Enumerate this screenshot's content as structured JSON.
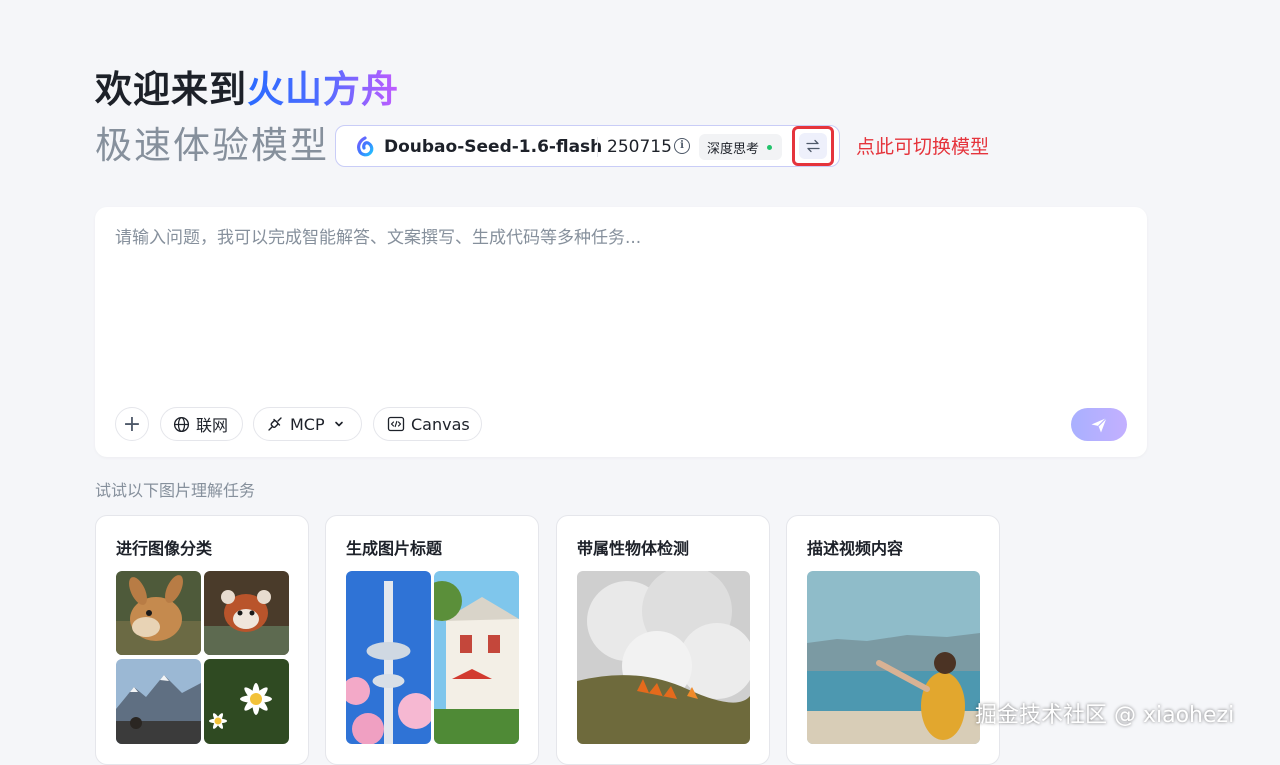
{
  "header": {
    "welcome_prefix": "欢迎来到",
    "welcome_brand": "火山方舟",
    "subtitle": "极速体验模型"
  },
  "model_selector": {
    "name": "Doubao-Seed-1.6-flash",
    "version": "250715",
    "mode_badge": "深度思考",
    "annotation": "点此可切换模型"
  },
  "input": {
    "placeholder": "请输入问题，我可以完成智能解答、文案撰写、生成代码等多种任务...",
    "value": ""
  },
  "toolbar": {
    "web_label": "联网",
    "mcp_label": "MCP",
    "canvas_label": "Canvas"
  },
  "examples": {
    "section_title": "试试以下图片理解任务",
    "cards": [
      {
        "title": "进行图像分类"
      },
      {
        "title": "生成图片标题"
      },
      {
        "title": "带属性物体检测"
      },
      {
        "title": "描述视频内容"
      }
    ]
  },
  "watermark": "掘金技术社区 @ xiaohezi",
  "colors": {
    "accent": "#2b6bff",
    "brand_gradient_end": "#c35bff",
    "annotation": "#e5343c",
    "status_dot": "#22c36b"
  }
}
